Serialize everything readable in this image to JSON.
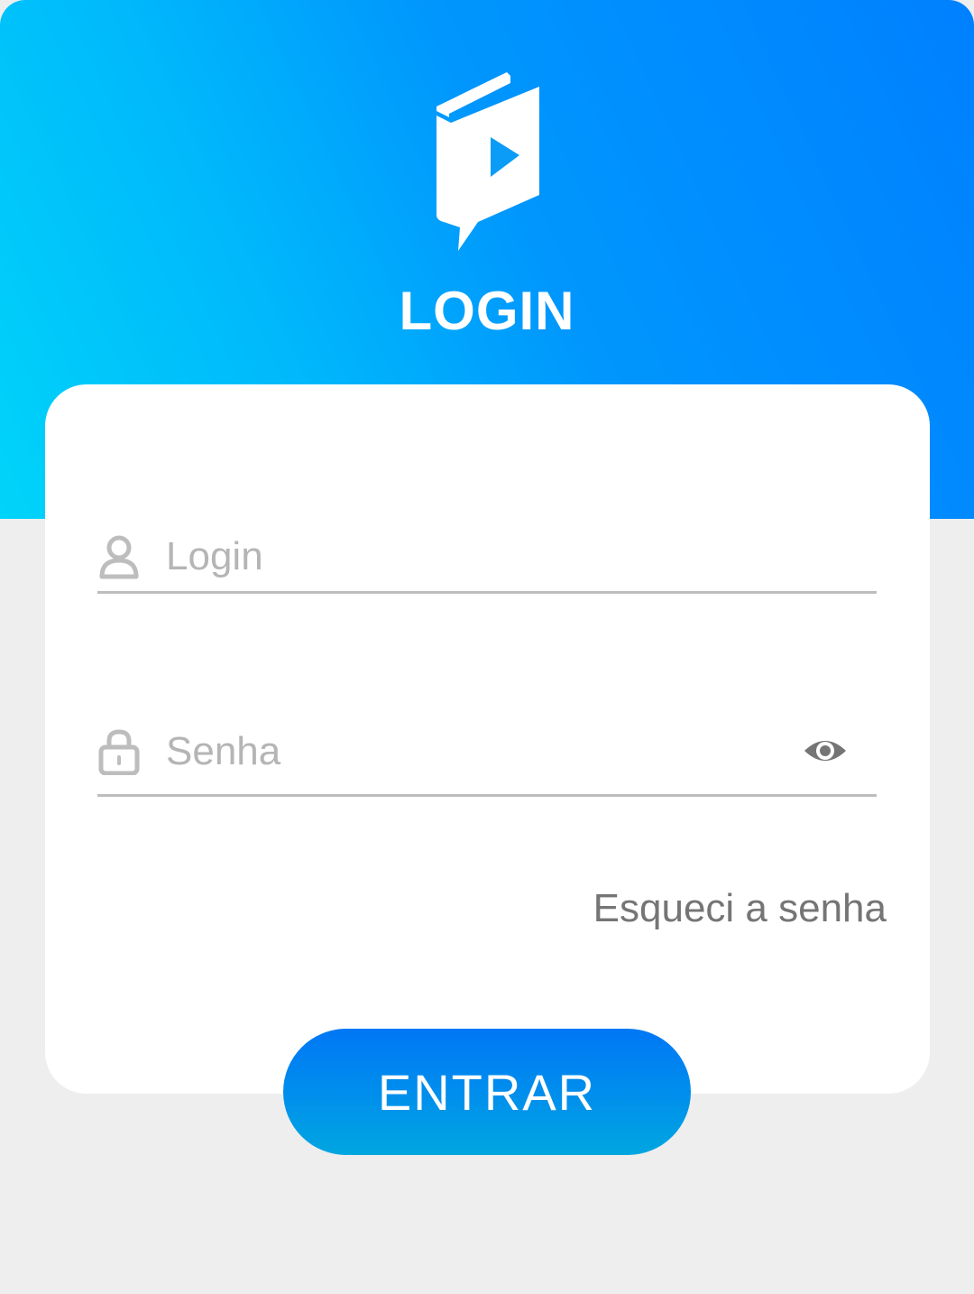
{
  "header": {
    "logo_icon": "book-play-speech-bubble-icon",
    "title": "LOGIN",
    "gradient": [
      "#00d4fa",
      "#0080ff"
    ]
  },
  "form": {
    "login": {
      "icon": "user-icon",
      "placeholder": "Login",
      "value": ""
    },
    "password": {
      "icon": "lock-icon",
      "placeholder": "Senha",
      "value": "",
      "toggle_icon": "eye-icon"
    },
    "forgot_label": "Esqueci a senha",
    "submit_label": "ENTRAR"
  },
  "colors": {
    "accent": "#0080ff",
    "field_line": "#bdbdbd",
    "placeholder": "#b5b5b5",
    "link": "#757575",
    "background": "#eeeeee"
  }
}
